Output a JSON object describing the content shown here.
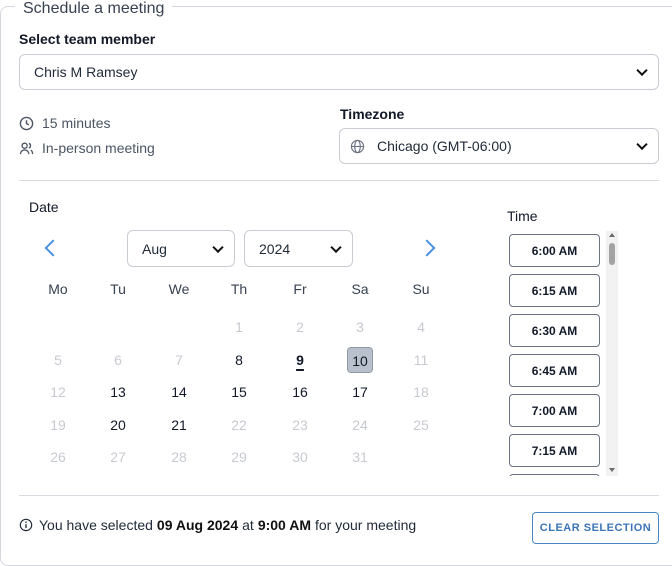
{
  "legend": "Schedule a meeting",
  "team_member": {
    "label": "Select team member",
    "value": "Chris M Ramsey"
  },
  "meeting": {
    "duration": "15 minutes",
    "type": "In-person meeting"
  },
  "timezone": {
    "label": "Timezone",
    "value": "Chicago (GMT-06:00)"
  },
  "date": {
    "label": "Date",
    "month": "Aug",
    "year": "2024"
  },
  "weekdays": [
    "Mo",
    "Tu",
    "We",
    "Th",
    "Fr",
    "Sa",
    "Su"
  ],
  "calendar_days": [
    {
      "d": "1",
      "state": "muted"
    },
    {
      "d": "2",
      "state": "muted"
    },
    {
      "d": "3",
      "state": "muted"
    },
    {
      "d": "4",
      "state": "muted"
    },
    {
      "d": "5",
      "state": "muted"
    },
    {
      "d": "6",
      "state": "muted"
    },
    {
      "d": "7",
      "state": "muted"
    },
    {
      "d": "8",
      "state": "active"
    },
    {
      "d": "9",
      "state": "today"
    },
    {
      "d": "10",
      "state": "selected"
    },
    {
      "d": "11",
      "state": "muted"
    },
    {
      "d": "12",
      "state": "muted"
    },
    {
      "d": "13",
      "state": "active"
    },
    {
      "d": "14",
      "state": "active"
    },
    {
      "d": "15",
      "state": "active"
    },
    {
      "d": "16",
      "state": "active"
    },
    {
      "d": "17",
      "state": "active"
    },
    {
      "d": "18",
      "state": "muted"
    },
    {
      "d": "19",
      "state": "muted"
    },
    {
      "d": "20",
      "state": "active"
    },
    {
      "d": "21",
      "state": "active"
    },
    {
      "d": "22",
      "state": "muted"
    },
    {
      "d": "23",
      "state": "muted"
    },
    {
      "d": "24",
      "state": "muted"
    },
    {
      "d": "25",
      "state": "muted"
    },
    {
      "d": "26",
      "state": "muted"
    },
    {
      "d": "27",
      "state": "muted"
    },
    {
      "d": "28",
      "state": "muted"
    },
    {
      "d": "29",
      "state": "muted"
    },
    {
      "d": "30",
      "state": "muted"
    },
    {
      "d": "31",
      "state": "muted"
    }
  ],
  "time": {
    "label": "Time",
    "slots": [
      "6:00 AM",
      "6:15 AM",
      "6:30 AM",
      "6:45 AM",
      "7:00 AM",
      "7:15 AM",
      ""
    ]
  },
  "summary": {
    "prefix": "You have selected",
    "date": "09 Aug 2024",
    "middle": "at",
    "time": "9:00 AM",
    "suffix": "for your meeting"
  },
  "clear_button": "CLEAR SELECTION",
  "colors": {
    "accent": "#4a86c7",
    "selected_day": "#b9c1cd",
    "muted_text": "#c7cad0"
  }
}
